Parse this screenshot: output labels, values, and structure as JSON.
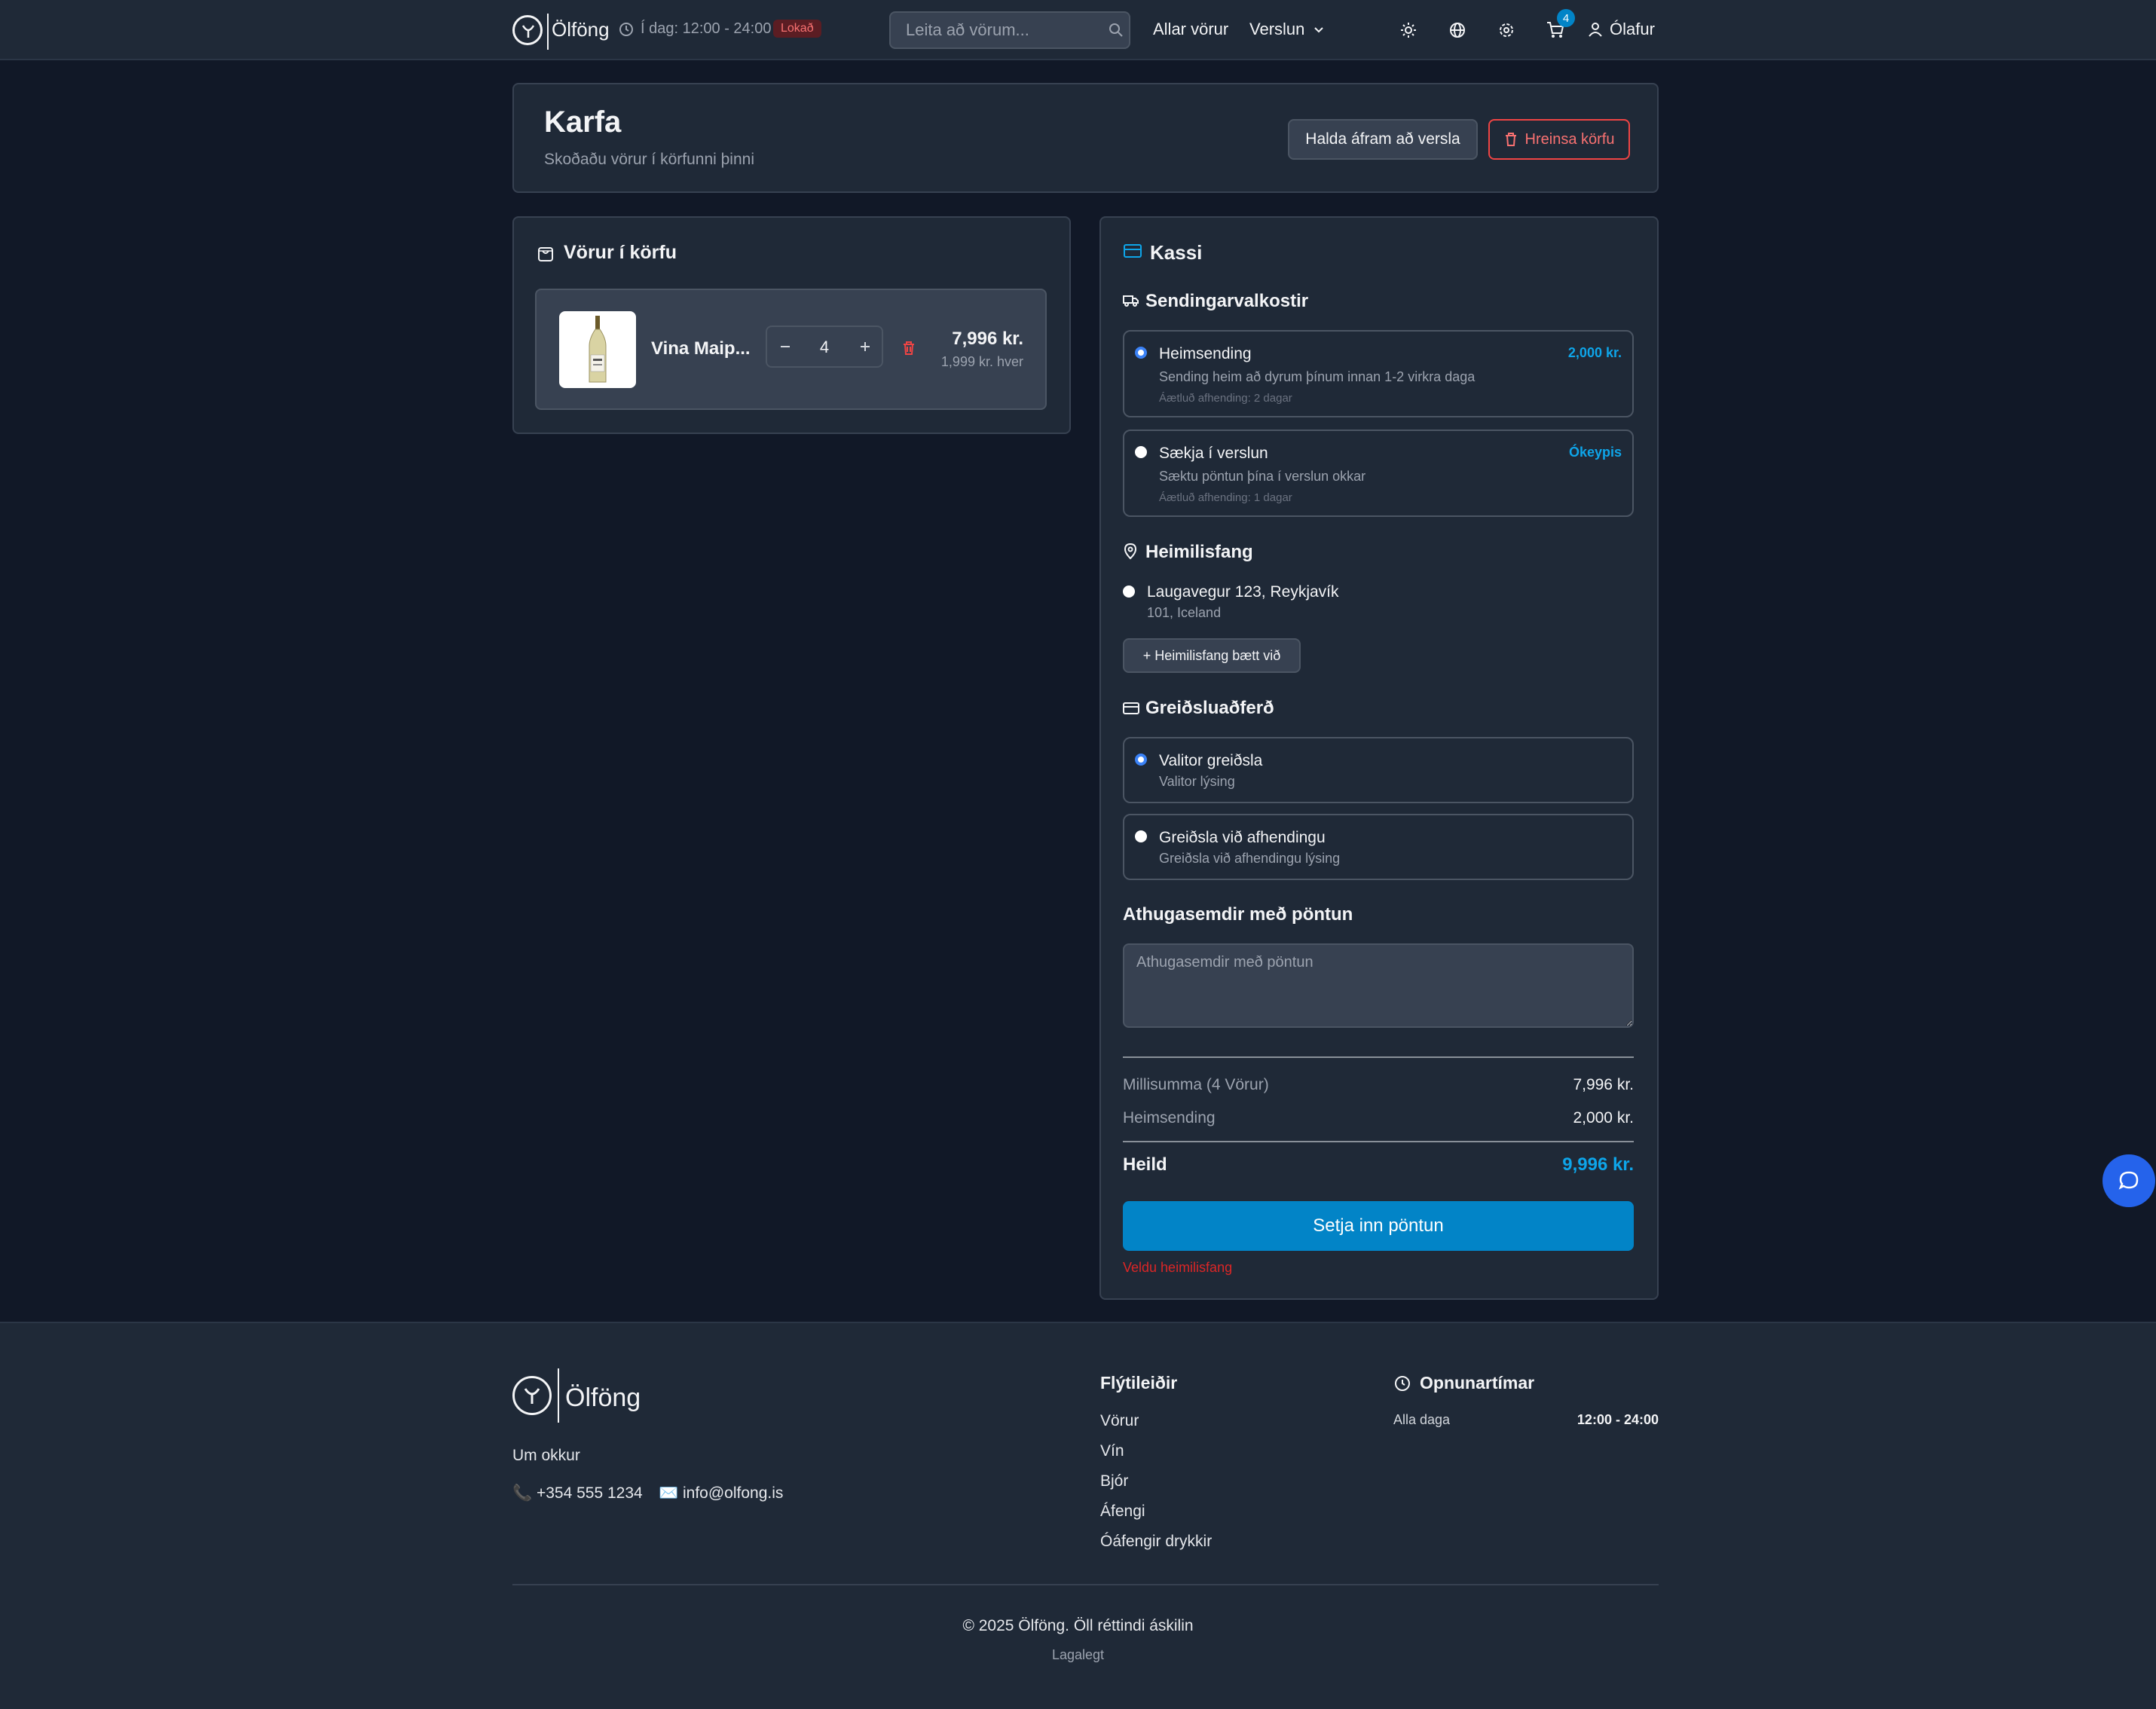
{
  "header": {
    "brand": "Ölföng",
    "hours_today": "Í dag: 12:00 - 24:00",
    "status_badge": "Lokað",
    "search_placeholder": "Leita að vörum...",
    "nav_all_products": "Allar vörur",
    "nav_shop": "Verslun",
    "cart_count": "4",
    "user_name": "Ólafur",
    "icons": [
      "clock-icon",
      "search-icon",
      "chevron-down-icon",
      "sun-icon",
      "globe-icon",
      "gear-icon",
      "cart-icon",
      "user-icon"
    ]
  },
  "page": {
    "title": "Karfa",
    "subtitle": "Skoðaðu vörur í körfunni þinni",
    "continue_button": "Halda áfram að versla",
    "clear_button": "Hreinsa körfu"
  },
  "cart": {
    "heading": "Vörur í körfu",
    "items": [
      {
        "name": "Vina Maip...",
        "quantity": "4",
        "total": "7,996 kr.",
        "unit_price": "1,999 kr. hver"
      }
    ]
  },
  "checkout": {
    "heading": "Kassi",
    "shipping_heading": "Sendingarvalkostir",
    "shipping_options": [
      {
        "name": "Heimsending",
        "price": "2,000 kr.",
        "description": "Sending heim að dyrum þínum innan 1-2 virkra daga",
        "estimate": "Áætluð afhending: 2 dagar",
        "selected": true
      },
      {
        "name": "Sækja í verslun",
        "price": "Ókeypis",
        "description": "Sæktu pöntun þína í verslun okkar",
        "estimate": "Áætluð afhending: 1 dagar",
        "selected": false
      }
    ],
    "address_heading": "Heimilisfang",
    "address_line1": "Laugavegur 123, Reykjavík",
    "address_line2": "101, Iceland",
    "add_address_button": "+ Heimilisfang bætt við",
    "payment_heading": "Greiðsluaðferð",
    "payment_options": [
      {
        "name": "Valitor greiðsla",
        "description": "Valitor lýsing",
        "selected": true
      },
      {
        "name": "Greiðsla við afhendingu",
        "description": "Greiðsla við afhendingu lýsing",
        "selected": false
      }
    ],
    "notes_heading": "Athugasemdir með pöntun",
    "notes_placeholder": "Athugasemdir með pöntun",
    "subtotal_label": "Millisumma (4 Vörur)",
    "subtotal_value": "7,996 kr.",
    "shipping_label": "Heimsending",
    "shipping_value": "2,000 kr.",
    "total_label": "Heild",
    "total_value": "9,996 kr.",
    "submit_button": "Setja inn pöntun",
    "error_text": "Veldu heimilisfang"
  },
  "footer": {
    "about": "Um okkur",
    "phone": "📞 +354 555 1234",
    "email": "✉️ info@olfong.is",
    "shortcuts_heading": "Flýtileiðir",
    "shortcuts": [
      "Vörur",
      "Vín",
      "Bjór",
      "Áfengi",
      "Óáfengir drykkir"
    ],
    "hours_heading": "Opnunartímar",
    "hours_days": "Alla daga",
    "hours_time": "12:00 - 24:00",
    "copyright": "© 2025 Ölföng. Öll réttindi áskilin",
    "legal": "Lagalegt"
  },
  "colors": {
    "background": "#111827",
    "surface": "#1f2937",
    "accent": "#0284c7",
    "danger": "#ef4444",
    "radio_selected": "#3b82f6"
  }
}
